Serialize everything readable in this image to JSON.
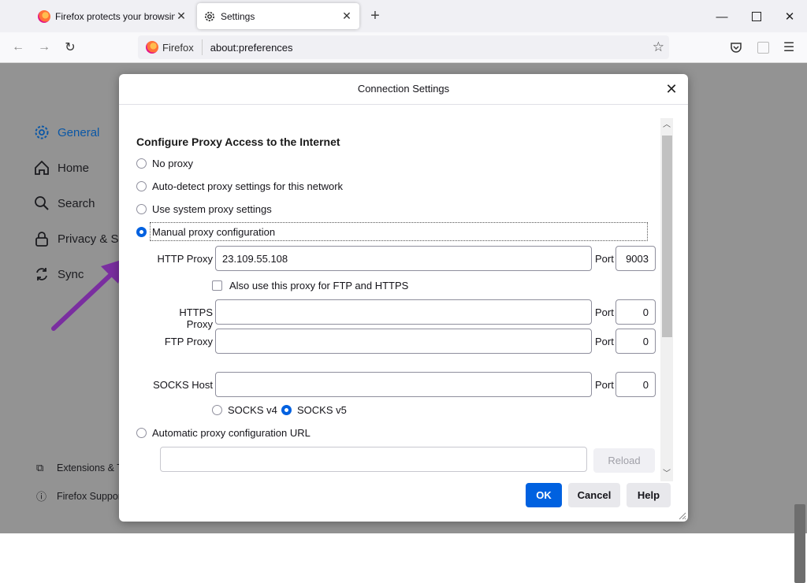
{
  "tabs": [
    {
      "title": "Firefox protects your browsing. Y",
      "favicon": "firefox-icon",
      "active": false
    },
    {
      "title": "Settings",
      "favicon": "gear-icon",
      "active": true
    }
  ],
  "toolbar": {
    "identity_label": "Firefox",
    "url": "about:preferences"
  },
  "sidebar": {
    "items": [
      {
        "label": "General",
        "icon": "gear-icon",
        "active": true
      },
      {
        "label": "Home",
        "icon": "home-icon"
      },
      {
        "label": "Search",
        "icon": "search-icon"
      },
      {
        "label": "Privacy & Se",
        "icon": "lock-icon"
      },
      {
        "label": "Sync",
        "icon": "sync-icon"
      }
    ],
    "footer": [
      {
        "label": "Extensions & T",
        "icon": "puzzle-icon"
      },
      {
        "label": "Firefox Suppor",
        "icon": "help-icon"
      }
    ]
  },
  "dialog": {
    "title": "Connection Settings",
    "heading": "Configure Proxy Access to the Internet",
    "options": {
      "no_proxy": "No proxy",
      "auto_detect": "Auto-detect proxy settings for this network",
      "system": "Use system proxy settings",
      "manual": "Manual proxy configuration",
      "auto_url": "Automatic proxy configuration URL"
    },
    "selected_option": "manual",
    "http_proxy": {
      "label": "HTTP Proxy",
      "value": "23.109.55.108",
      "port_label": "Port",
      "port": "9003"
    },
    "also_use": {
      "label": "Also use this proxy for FTP and HTTPS",
      "checked": false
    },
    "https_proxy": {
      "label": "HTTPS Proxy",
      "value": "",
      "port_label": "Port",
      "port": "0"
    },
    "ftp_proxy": {
      "label": "FTP Proxy",
      "value": "",
      "port_label": "Port",
      "port": "0"
    },
    "socks_host": {
      "label": "SOCKS Host",
      "value": "",
      "port_label": "Port",
      "port": "0"
    },
    "socks_v4": "SOCKS v4",
    "socks_v5": "SOCKS v5",
    "socks_version_selected": "v5",
    "auto_url_value": "",
    "reload_label": "Reload",
    "buttons": {
      "ok": "OK",
      "cancel": "Cancel",
      "help": "Help"
    }
  },
  "colors": {
    "accent": "#0061e0",
    "annotation_arrow": "#7a2ea0",
    "overlay": "#939393"
  }
}
